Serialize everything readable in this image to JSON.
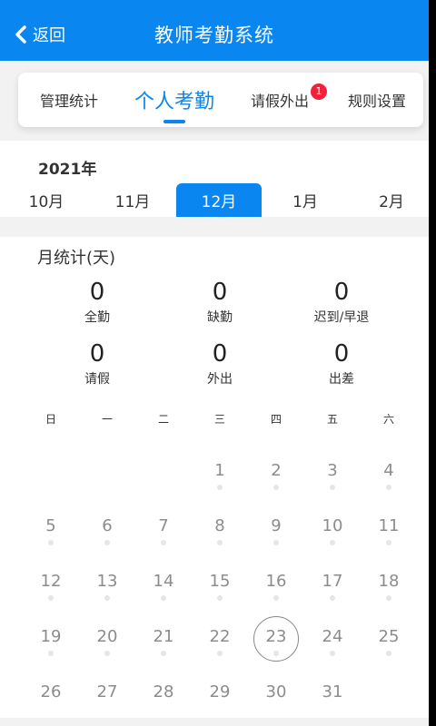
{
  "header": {
    "back_label": "返回",
    "title": "教师考勤系统",
    "background": "#0a86f0"
  },
  "tabs": [
    {
      "label": "管理统计",
      "active": false
    },
    {
      "label": "个人考勤",
      "active": true
    },
    {
      "label": "请假外出",
      "active": false,
      "badge": "1"
    },
    {
      "label": "规则设置",
      "active": false
    }
  ],
  "calendar_header": {
    "year": "2021年",
    "months": [
      "10月",
      "11月",
      "12月",
      "1月",
      "2月"
    ],
    "selected_month": "12月"
  },
  "stats": {
    "title": "月统计(天)",
    "items": [
      {
        "value": "0",
        "label": "全勤"
      },
      {
        "value": "0",
        "label": "缺勤"
      },
      {
        "value": "0",
        "label": "迟到/早退"
      },
      {
        "value": "0",
        "label": "请假"
      },
      {
        "value": "0",
        "label": "外出"
      },
      {
        "value": "0",
        "label": "出差"
      }
    ]
  },
  "calendar": {
    "weekdays": [
      "日",
      "一",
      "二",
      "三",
      "四",
      "五",
      "六"
    ],
    "days": [
      "",
      "",
      "",
      "1",
      "2",
      "3",
      "4",
      "5",
      "6",
      "7",
      "8",
      "9",
      "10",
      "11",
      "12",
      "13",
      "14",
      "15",
      "16",
      "17",
      "18",
      "19",
      "20",
      "21",
      "22",
      "23",
      "24",
      "25",
      "26",
      "27",
      "28",
      "29",
      "30",
      "31",
      ""
    ],
    "today": "23"
  }
}
